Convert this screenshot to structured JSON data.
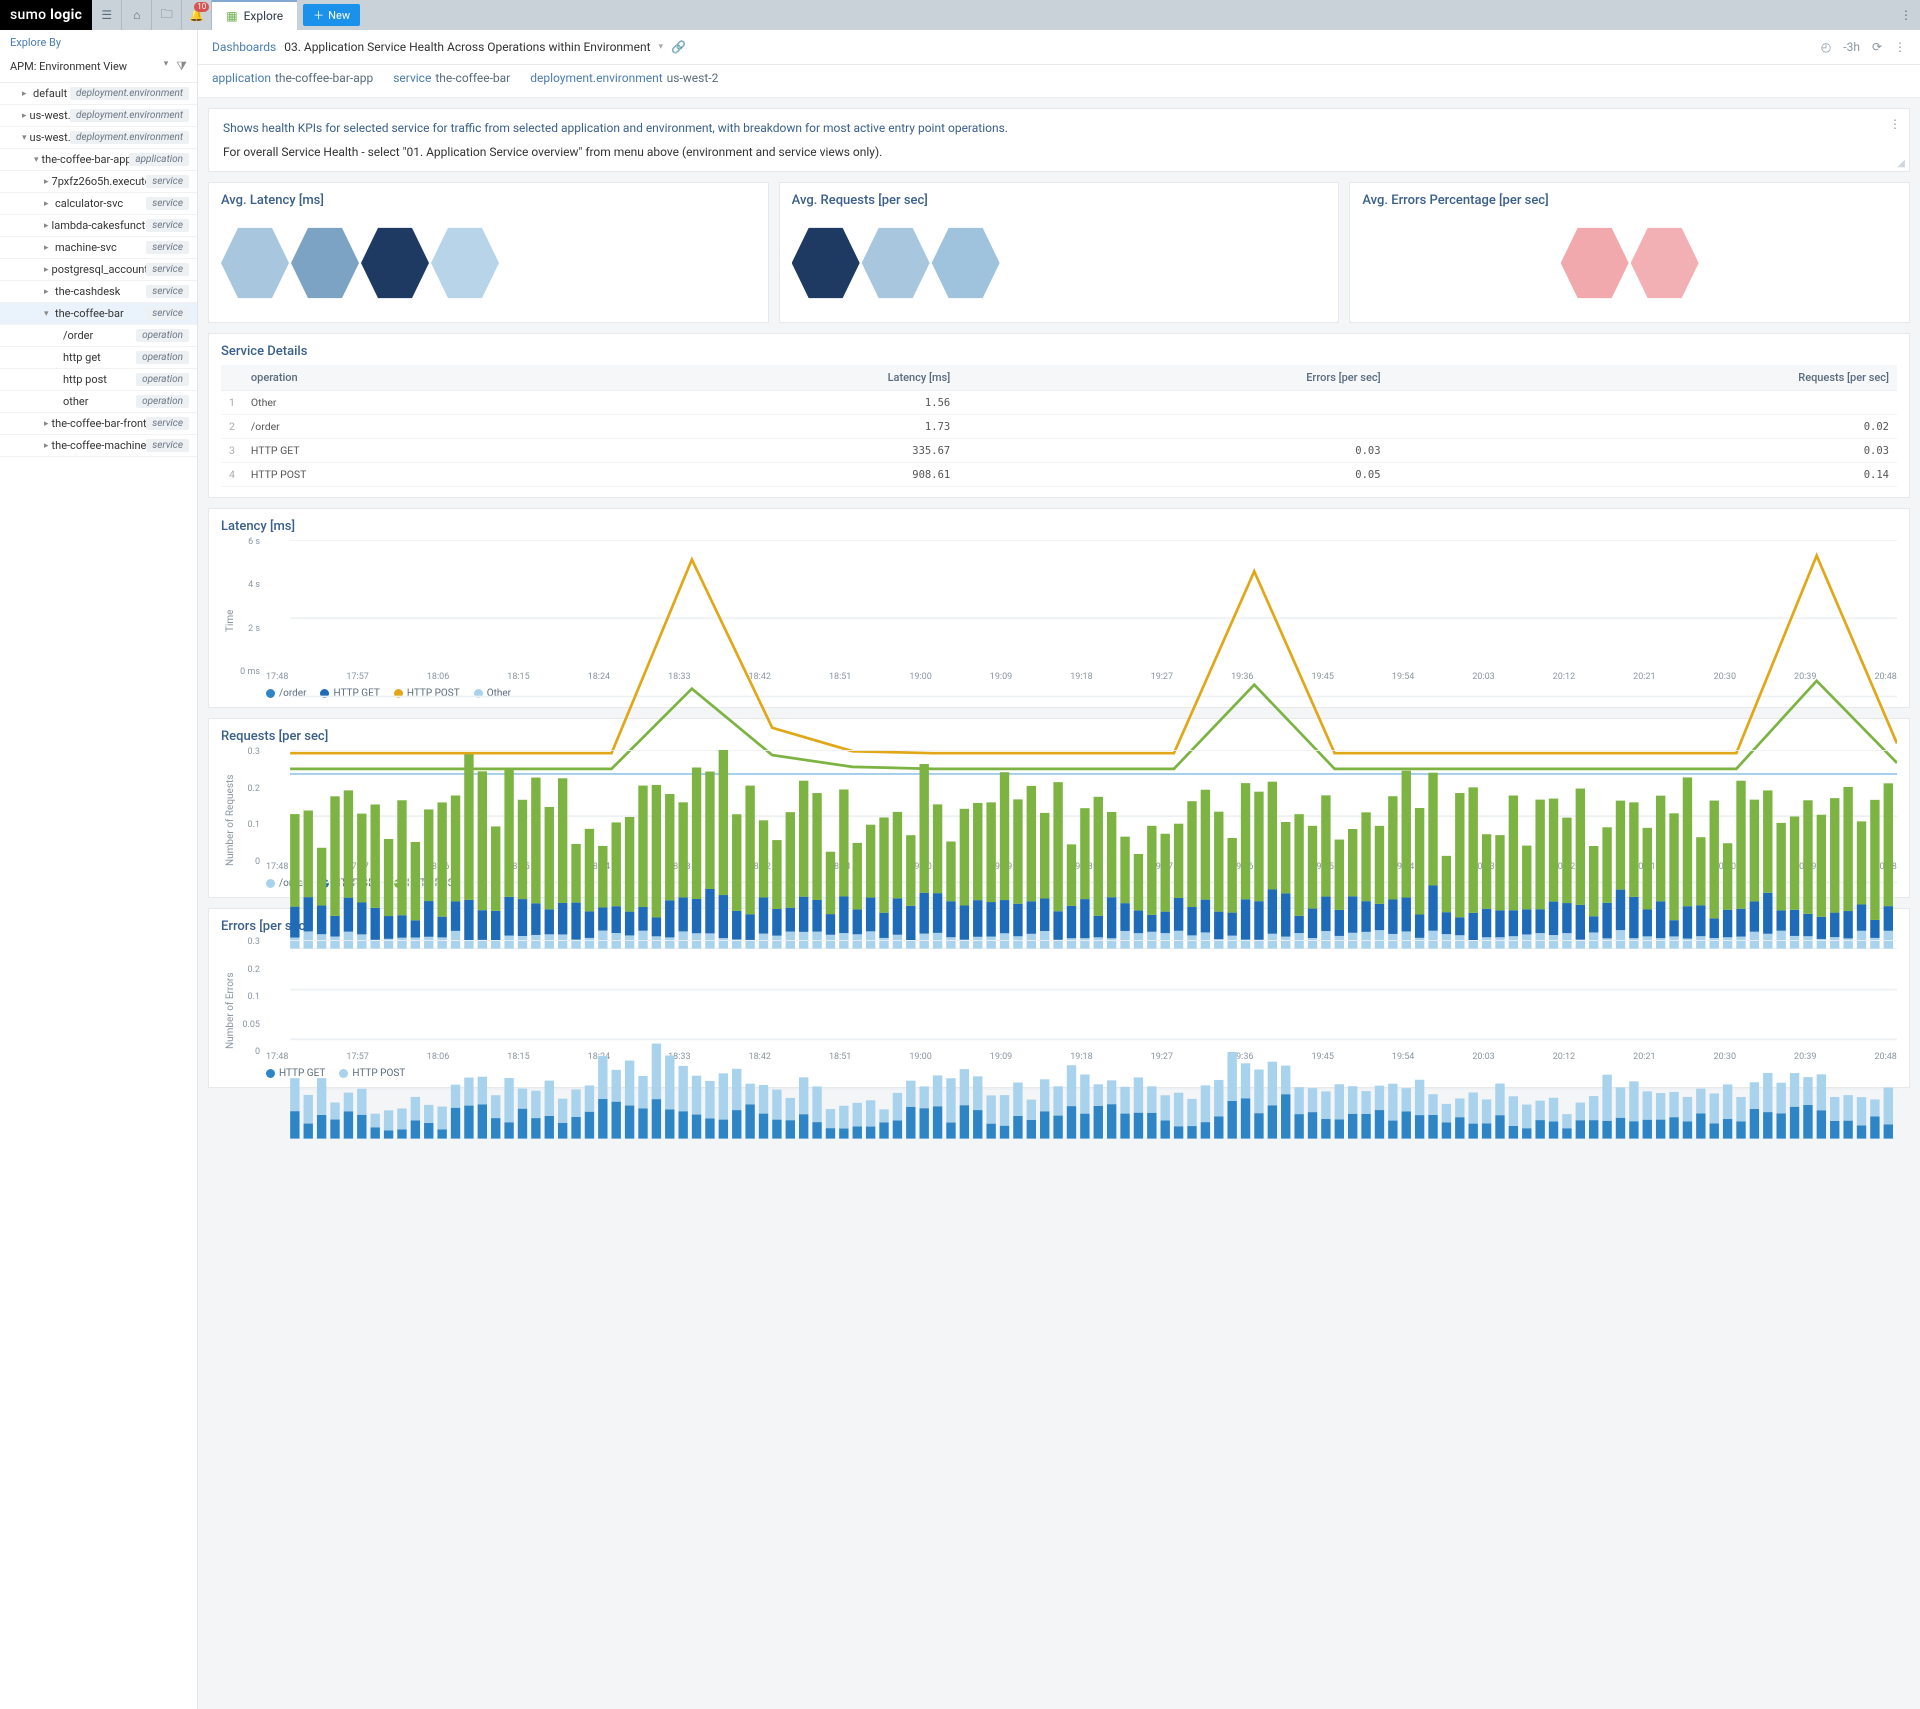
{
  "brand": {
    "sumo": "sumo",
    "logic": "logic"
  },
  "topbar": {
    "tab": "Explore",
    "new": "New",
    "badge": "10",
    "time_label": "-3h"
  },
  "sidebar": {
    "explore_by": "Explore By",
    "apm_select": "APM: Environment View",
    "items": [
      {
        "label": "default",
        "tag": "deployment.environment",
        "indent": 1,
        "arrow": "▸"
      },
      {
        "label": "us-west...",
        "tag": "deployment.environment",
        "indent": 1,
        "arrow": "▸"
      },
      {
        "label": "us-west...",
        "tag": "deployment.environment",
        "indent": 1,
        "arrow": "▾"
      },
      {
        "label": "the-coffee-bar-app",
        "tag": "application",
        "indent": 2,
        "arrow": "▾"
      },
      {
        "label": "7pxfz26o5h.execute...",
        "tag": "service",
        "indent": 3,
        "arrow": "▸"
      },
      {
        "label": "calculator-svc",
        "tag": "service",
        "indent": 3,
        "arrow": "▸"
      },
      {
        "label": "lambda-cakesfuncti...",
        "tag": "service",
        "indent": 3,
        "arrow": "▸"
      },
      {
        "label": "machine-svc",
        "tag": "service",
        "indent": 3,
        "arrow": "▸"
      },
      {
        "label": "postgresql_account",
        "tag": "service",
        "indent": 3,
        "arrow": "▸"
      },
      {
        "label": "the-cashdesk",
        "tag": "service",
        "indent": 3,
        "arrow": "▸"
      },
      {
        "label": "the-coffee-bar",
        "tag": "service",
        "indent": 3,
        "arrow": "▾",
        "sel": true
      },
      {
        "label": "/order",
        "tag": "operation",
        "indent": 4,
        "arrow": ""
      },
      {
        "label": "http get",
        "tag": "operation",
        "indent": 4,
        "arrow": ""
      },
      {
        "label": "http post",
        "tag": "operation",
        "indent": 4,
        "arrow": ""
      },
      {
        "label": "other",
        "tag": "operation",
        "indent": 4,
        "arrow": ""
      },
      {
        "label": "the-coffee-bar-front...",
        "tag": "service",
        "indent": 3,
        "arrow": "▸"
      },
      {
        "label": "the-coffee-machine",
        "tag": "service",
        "indent": 3,
        "arrow": "▸"
      }
    ]
  },
  "breadcrumb": {
    "a": "Dashboards",
    "b": "03. Application Service Health Across Operations within Environment"
  },
  "tags": [
    {
      "k": "application",
      "v": "the-coffee-bar-app"
    },
    {
      "k": "service",
      "v": "the-coffee-bar"
    },
    {
      "k": "deployment.environment",
      "v": "us-west-2"
    }
  ],
  "info": {
    "line1": "Shows health KPIs for selected service for traffic from selected application and environment, with breakdown for most active entry point operations.",
    "line2": "For overall Service Health - select \"01. Application Service overview\" from menu above (environment and service views only)."
  },
  "honeycombs": {
    "latency": {
      "title": "Avg. Latency [ms]",
      "colors": [
        "#a8c7df",
        "#7ca2c4",
        "#1e3a63",
        "#b7d4e8"
      ]
    },
    "requests": {
      "title": "Avg. Requests [per sec]",
      "colors": [
        "#1e3a63",
        "#a8c7df",
        "#9fc3dc"
      ]
    },
    "errors": {
      "title": "Avg. Errors Percentage [per sec]",
      "colors": [
        "#f2a9ae",
        "#f2b0b4"
      ]
    }
  },
  "details": {
    "title": "Service Details",
    "headers": {
      "op": "operation",
      "lat": "Latency [ms]",
      "err": "Errors [per sec]",
      "req": "Requests [per sec]"
    },
    "rows": [
      {
        "i": "1",
        "op": "Other",
        "lat": "1.56",
        "err": "",
        "req": ""
      },
      {
        "i": "2",
        "op": "/order",
        "lat": "1.73",
        "err": "",
        "req": "0.02"
      },
      {
        "i": "3",
        "op": "HTTP GET",
        "lat": "335.67",
        "err": "0.03",
        "req": "0.03"
      },
      {
        "i": "4",
        "op": "HTTP POST",
        "lat": "908.61",
        "err": "0.05",
        "req": "0.14"
      }
    ]
  },
  "legend_series": {
    "latency": [
      "/order",
      "HTTP GET",
      "HTTP POST",
      "Other"
    ],
    "requests": [
      "/order",
      "HTTP GET",
      "HTTP POST"
    ],
    "errors": [
      "HTTP GET",
      "HTTP POST"
    ]
  },
  "colors": {
    "order": "#2d85c5",
    "httpget": "#1e6bb8",
    "httppost": "#7cb342",
    "other": "#a9d2ec",
    "httppost_line": "#e0a818",
    "httpget_bar": "#1e6bb8",
    "httppost_bar": "#7cb342",
    "order_bar": "#a9d2ec",
    "err_get": "#2d85c5",
    "err_post": "#a9d2ec"
  },
  "chart_titles": {
    "latency": "Latency [ms]",
    "requests": "Requests [per sec]",
    "errors": "Errors [per sec]"
  },
  "y_axis": {
    "latency": "Time",
    "requests": "Number of Requests",
    "errors": "Number of Errors"
  },
  "chart_data": [
    {
      "type": "line",
      "title": "Latency [ms]",
      "xlabel": "",
      "ylabel": "Time",
      "ylim": [
        0,
        6
      ],
      "yticks": [
        "0 ms",
        "2 s",
        "4 s",
        "6 s"
      ],
      "x": [
        "17:48",
        "17:57",
        "18:06",
        "18:15",
        "18:24",
        "18:33",
        "18:42",
        "18:51",
        "19:00",
        "19:09",
        "19:18",
        "19:27",
        "19:36",
        "19:45",
        "19:54",
        "20:03",
        "20:12",
        "20:21",
        "20:30",
        "20:39",
        "20:48"
      ],
      "series": [
        {
          "name": "/order",
          "color": "#2d85c5",
          "values": [
            0.002,
            0.002,
            0.002,
            0.002,
            0.002,
            0.002,
            0.002,
            0.002,
            0.002,
            0.002,
            0.002,
            0.002,
            0.002,
            0.002,
            0.002,
            0.002,
            0.002,
            0.002,
            0.002,
            0.002,
            0.002
          ]
        },
        {
          "name": "HTTP GET",
          "color": "#7cb342",
          "values": [
            0.15,
            0.15,
            0.15,
            0.15,
            0.15,
            2.2,
            0.5,
            0.2,
            0.15,
            0.15,
            0.15,
            0.15,
            2.3,
            0.15,
            0.15,
            0.15,
            0.15,
            0.15,
            0.15,
            2.4,
            0.3
          ]
        },
        {
          "name": "HTTP POST",
          "color": "#e0a818",
          "values": [
            0.55,
            0.55,
            0.55,
            0.55,
            0.55,
            5.5,
            1.2,
            0.6,
            0.55,
            0.55,
            0.55,
            0.55,
            5.2,
            0.55,
            0.55,
            0.55,
            0.55,
            0.55,
            0.55,
            5.6,
            0.8
          ]
        },
        {
          "name": "Other",
          "color": "#a9d2ec",
          "values": [
            0.001,
            0.001,
            0.001,
            0.001,
            0.001,
            0.001,
            0.001,
            0.001,
            0.001,
            0.001,
            0.001,
            0.001,
            0.001,
            0.001,
            0.001,
            0.001,
            0.001,
            0.001,
            0.001,
            0.001,
            0.001
          ]
        }
      ]
    },
    {
      "type": "bar",
      "title": "Requests [per sec]",
      "xlabel": "",
      "ylabel": "Number of Requests",
      "ylim": [
        0,
        0.3
      ],
      "yticks": [
        "0",
        "0.1",
        "0.2",
        "0.3"
      ],
      "x": [
        "17:48",
        "17:57",
        "18:06",
        "18:15",
        "18:24",
        "18:33",
        "18:42",
        "18:51",
        "19:00",
        "19:09",
        "19:18",
        "19:27",
        "19:36",
        "19:45",
        "19:54",
        "20:03",
        "20:12",
        "20:21",
        "20:30",
        "20:39",
        "20:48"
      ],
      "series": [
        {
          "name": "/order",
          "color": "#a9d2ec",
          "values": [
            0.02,
            0.02,
            0.02,
            0.02,
            0.02,
            0.02,
            0.02,
            0.02,
            0.02,
            0.02,
            0.02,
            0.02,
            0.02,
            0.02,
            0.02,
            0.02,
            0.02,
            0.02,
            0.02,
            0.02,
            0.02
          ]
        },
        {
          "name": "HTTP GET",
          "color": "#1e6bb8",
          "values": [
            0.04,
            0.04,
            0.05,
            0.04,
            0.04,
            0.05,
            0.04,
            0.04,
            0.05,
            0.04,
            0.05,
            0.04,
            0.05,
            0.04,
            0.05,
            0.04,
            0.04,
            0.05,
            0.04,
            0.05,
            0.04
          ]
        },
        {
          "name": "HTTP POST",
          "color": "#7cb342",
          "values": [
            0.14,
            0.13,
            0.16,
            0.14,
            0.15,
            0.17,
            0.14,
            0.13,
            0.15,
            0.14,
            0.15,
            0.13,
            0.14,
            0.13,
            0.15,
            0.14,
            0.13,
            0.15,
            0.14,
            0.15,
            0.14
          ]
        }
      ]
    },
    {
      "type": "bar",
      "title": "Errors [per sec]",
      "xlabel": "",
      "ylabel": "Number of Errors",
      "ylim": [
        0,
        0.3
      ],
      "yticks": [
        "0",
        "0.05",
        "0.1",
        "0.2",
        "0.3"
      ],
      "x": [
        "17:48",
        "17:57",
        "18:06",
        "18:15",
        "18:24",
        "18:33",
        "18:42",
        "18:51",
        "19:00",
        "19:09",
        "19:18",
        "19:27",
        "19:36",
        "19:45",
        "19:54",
        "20:03",
        "20:12",
        "20:21",
        "20:30",
        "20:39",
        "20:48"
      ],
      "series": [
        {
          "name": "HTTP GET",
          "color": "#2d85c5",
          "values": [
            0.03,
            0.02,
            0.04,
            0.03,
            0.05,
            0.04,
            0.03,
            0.02,
            0.04,
            0.03,
            0.04,
            0.03,
            0.05,
            0.03,
            0.04,
            0.03,
            0.02,
            0.04,
            0.03,
            0.04,
            0.03
          ]
        },
        {
          "name": "HTTP POST",
          "color": "#a9d2ec",
          "values": [
            0.04,
            0.03,
            0.05,
            0.04,
            0.06,
            0.05,
            0.04,
            0.03,
            0.05,
            0.04,
            0.05,
            0.04,
            0.06,
            0.04,
            0.05,
            0.04,
            0.03,
            0.05,
            0.04,
            0.05,
            0.04
          ]
        }
      ]
    }
  ]
}
